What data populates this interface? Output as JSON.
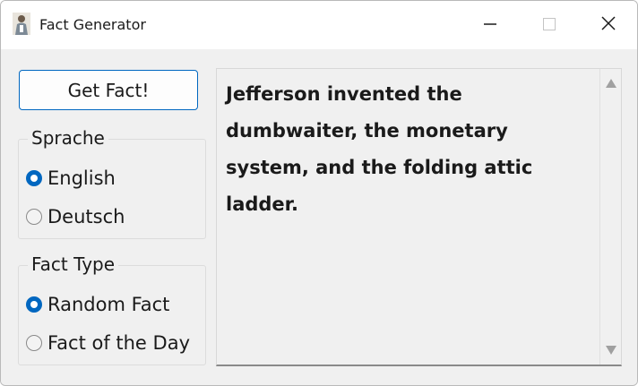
{
  "window": {
    "title": "Fact Generator",
    "icon": "portrait-icon"
  },
  "controls": {
    "get_fact_label": "Get Fact!"
  },
  "language_group": {
    "label": "Sprache",
    "options": [
      {
        "label": "English",
        "selected": true
      },
      {
        "label": "Deutsch",
        "selected": false
      }
    ]
  },
  "fact_type_group": {
    "label": "Fact Type",
    "options": [
      {
        "label": "Random Fact",
        "selected": true
      },
      {
        "label": "Fact of the Day",
        "selected": false
      }
    ]
  },
  "fact_display": {
    "text": "Jefferson invented the dumbwaiter, the monetary system, and the folding attic ladder."
  },
  "colors": {
    "accent": "#0067c0",
    "window_bg": "#f0f0f0",
    "titlebar_bg": "#ffffff"
  }
}
